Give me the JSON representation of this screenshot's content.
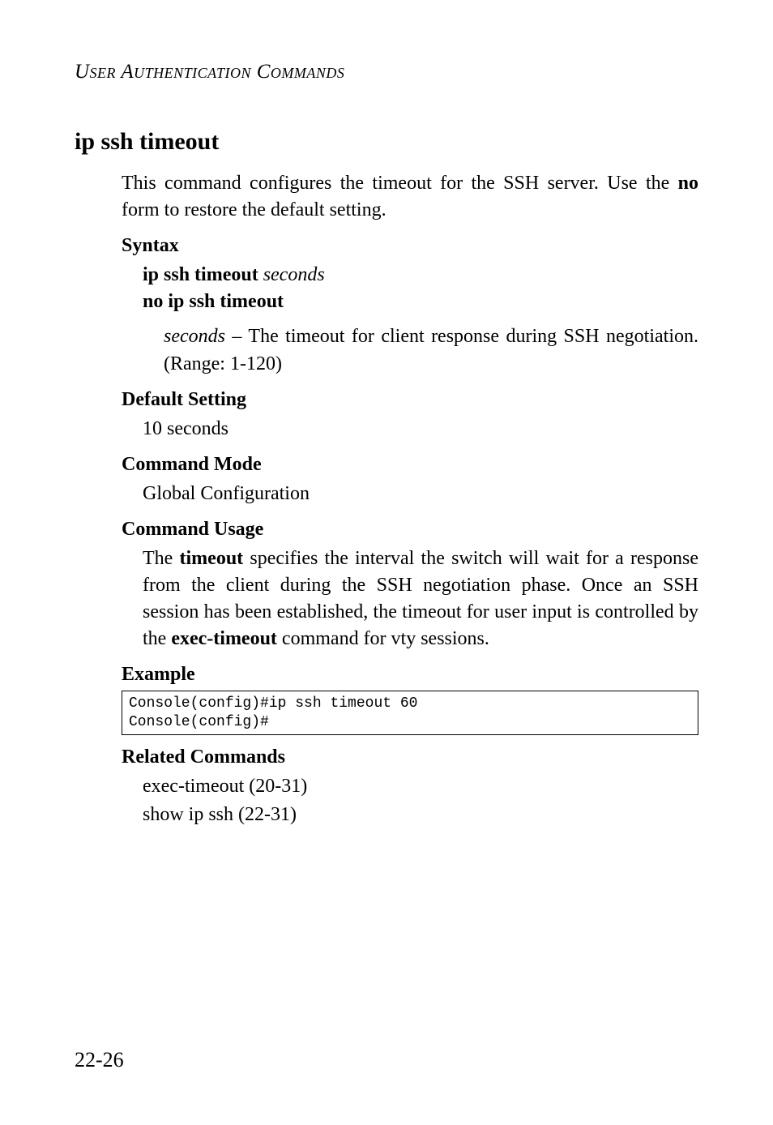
{
  "running_head": "User Authentication Commands",
  "title": "ip ssh timeout",
  "intro_pre": "This command configures the timeout for the SSH server. Use the ",
  "intro_bold": "no",
  "intro_post": " form to restore the default setting.",
  "syntax": {
    "heading": "Syntax",
    "line1_bold": "ip ssh timeout ",
    "line1_italic": "seconds",
    "line2_bold": "no ip ssh timeout",
    "param_italic": "seconds",
    "param_rest": " – The timeout for client response during SSH negotiation. (Range: 1-120)"
  },
  "default": {
    "heading": "Default Setting",
    "value": "10 seconds"
  },
  "mode": {
    "heading": "Command Mode",
    "value": "Global Configuration"
  },
  "usage": {
    "heading": "Command Usage",
    "pre": "The ",
    "bold1": "timeout",
    "mid": " specifies the interval the switch will wait for a response from the client during the SSH negotiation phase. Once an SSH session has been established, the timeout for user input is controlled by the ",
    "bold2": "exec-timeout",
    "post": " command for vty sessions."
  },
  "example": {
    "heading": "Example",
    "code": "Console(config)#ip ssh timeout 60\nConsole(config)#"
  },
  "related": {
    "heading": "Related Commands",
    "line1": "exec-timeout (20-31)",
    "line2": "show ip ssh (22-31)"
  },
  "page_number": "22-26"
}
